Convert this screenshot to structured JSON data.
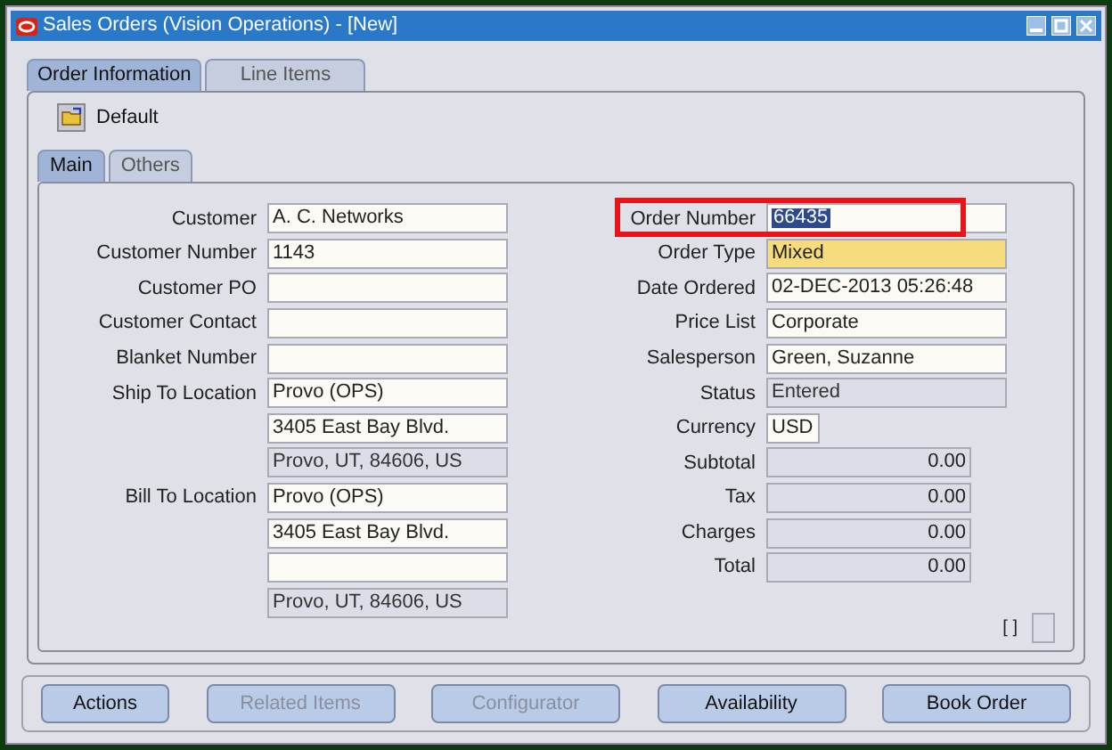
{
  "window": {
    "title": "Sales Orders (Vision Operations) - [New]"
  },
  "tabs": [
    {
      "label": "Order Information",
      "selected": true
    },
    {
      "label": "Line Items",
      "selected": false
    }
  ],
  "toolbar": {
    "default_label": "Default"
  },
  "subtabs": [
    {
      "label": "Main",
      "selected": true
    },
    {
      "label": "Others",
      "selected": false
    }
  ],
  "left_fields": [
    {
      "label": "Customer",
      "value": "A. C. Networks",
      "kind": "text"
    },
    {
      "label": "Customer Number",
      "value": "1143",
      "kind": "text"
    },
    {
      "label": "Customer PO",
      "kind": "text"
    },
    {
      "label": "Customer Contact",
      "kind": "text"
    },
    {
      "label": "Blanket Number",
      "kind": "text"
    },
    {
      "label": "Ship To Location",
      "value": "Provo (OPS)",
      "kind": "text"
    },
    {
      "value": "3405 East Bay Blvd.",
      "kind": "text"
    },
    {
      "value": "Provo, UT, 84606, US",
      "kind": "readonly"
    },
    {
      "label": "Bill To Location",
      "value": "Provo (OPS)",
      "kind": "text"
    },
    {
      "value": "3405 East Bay Blvd.",
      "kind": "text"
    },
    {
      "kind": "text"
    },
    {
      "value": "Provo, UT, 84606, US",
      "kind": "readonly"
    }
  ],
  "right_fields": [
    {
      "label": "Order Number",
      "value": "66435",
      "kind": "text",
      "highlighted": true
    },
    {
      "label": "Order Type",
      "value": "Mixed",
      "kind": "required"
    },
    {
      "label": "Date Ordered",
      "value": "02-DEC-2013 05:26:48",
      "kind": "text"
    },
    {
      "label": "Price List",
      "value": "Corporate",
      "kind": "text"
    },
    {
      "label": "Salesperson",
      "value": "Green, Suzanne",
      "kind": "text"
    },
    {
      "label": "Status",
      "value": "Entered",
      "kind": "readonly"
    },
    {
      "label": "Currency",
      "value": "USD",
      "kind": "short"
    },
    {
      "label": "Subtotal",
      "value": "0.00",
      "kind": "amount"
    },
    {
      "label": "Tax",
      "value": "0.00",
      "kind": "amount"
    },
    {
      "label": "Charges",
      "value": "0.00",
      "kind": "amount"
    },
    {
      "label": "Total",
      "value": "0.00",
      "kind": "amount"
    }
  ],
  "flag": "[ ]",
  "flag_box": {
    "checked": false
  },
  "buttons": [
    {
      "label": "Actions",
      "disabled": false
    },
    {
      "label": "Related Items",
      "disabled": true
    },
    {
      "label": "Configurator",
      "disabled": true
    },
    {
      "label": "Availability",
      "disabled": false
    },
    {
      "label": "Book Order",
      "disabled": false
    }
  ]
}
